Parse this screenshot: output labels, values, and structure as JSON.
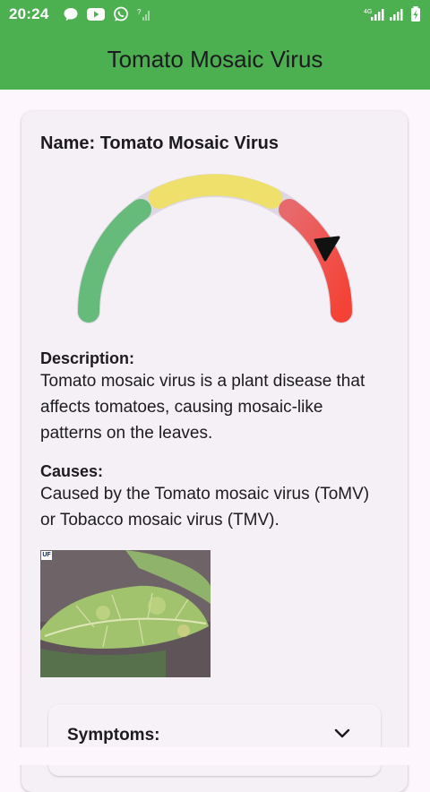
{
  "status_bar": {
    "time": "20:24",
    "notification_icons": [
      "chat-bubble-icon",
      "youtube-icon",
      "whatsapp-icon",
      "no-signal-icon"
    ],
    "system_icons": [
      "4g-signal-icon",
      "signal-icon",
      "battery-charging-icon"
    ]
  },
  "app_bar": {
    "title": "Tomato Mosaic Virus"
  },
  "disease": {
    "name_label": "Name: Tomato Mosaic Virus",
    "severity_gauge": {
      "segments": [
        "green",
        "yellow",
        "red"
      ],
      "pointer_level": 0.82,
      "colors": {
        "green": "#66bb7a",
        "yellow": "#efe06c",
        "red_start": "#e8696c",
        "red_end": "#f44336"
      }
    },
    "description_heading": "Description:",
    "description_text": "Tomato mosaic virus is a plant disease that affects tomatoes, causing mosaic-like patterns on the leaves.",
    "causes_heading": "Causes:",
    "causes_text": "Caused by the Tomato mosaic virus (ToMV) or Tobacco mosaic virus (TMV).",
    "photo_tag": "UF",
    "symptoms_heading": "Symptoms:"
  },
  "colors": {
    "primary": "#4caf50",
    "card": "#f4f0f6"
  }
}
